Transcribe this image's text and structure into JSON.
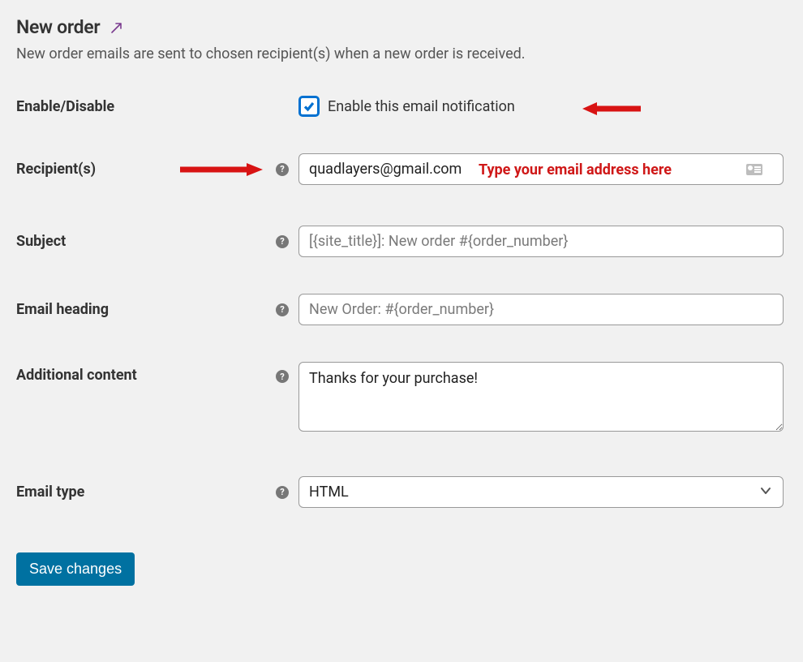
{
  "heading": "New order",
  "description": "New order emails are sent to chosen recipient(s) when a new order is received.",
  "enable": {
    "label": "Enable/Disable",
    "checkbox_label": "Enable this email notification",
    "checked": true
  },
  "recipients": {
    "label": "Recipient(s)",
    "value": "quadlayers@gmail.com",
    "placeholder": ""
  },
  "subject": {
    "label": "Subject",
    "value": "",
    "placeholder": "[{site_title}]: New order #{order_number}"
  },
  "email_heading": {
    "label": "Email heading",
    "value": "",
    "placeholder": "New Order: #{order_number}"
  },
  "additional_content": {
    "label": "Additional content",
    "value": "Thanks for your purchase!"
  },
  "email_type": {
    "label": "Email type",
    "selected": "HTML"
  },
  "save_button_label": "Save changes",
  "annotations": {
    "recipients_hint": "Type your email address here"
  }
}
